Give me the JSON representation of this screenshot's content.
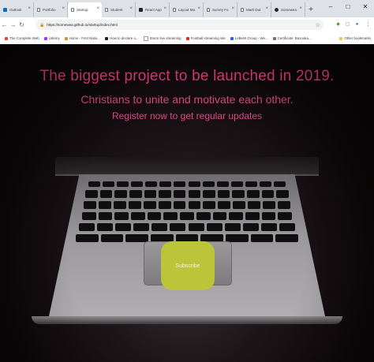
{
  "browser": {
    "tabs": [
      {
        "title": "Outlook",
        "icon": "outlook-icon"
      },
      {
        "title": "Portfolio",
        "icon": "document-icon"
      },
      {
        "title": "Startup",
        "icon": "document-icon",
        "active": true
      },
      {
        "title": "Student",
        "icon": "document-icon"
      },
      {
        "title": "React App",
        "icon": "react-icon"
      },
      {
        "title": "Layout Ma",
        "icon": "document-icon"
      },
      {
        "title": "Survey Fo",
        "icon": "document-icon"
      },
      {
        "title": "Mark Out",
        "icon": "document-icon"
      },
      {
        "title": "Somewea",
        "icon": "github-icon"
      }
    ],
    "new_tab_label": "+",
    "window_controls": {
      "minimize": "–",
      "maximize": "□",
      "close": "✕"
    },
    "url": "https://somewea.github.io/startup/index.html",
    "bookmarks": [
      {
        "label": "The Complete Web",
        "color": "#e04a3a"
      },
      {
        "label": "Udemy",
        "color": "#a435f0"
      },
      {
        "label": "Home - First Natio...",
        "color": "#c79a2e"
      },
      {
        "label": "How to declare o...",
        "color": "#202124"
      },
      {
        "label": "Storm live streaming",
        "color": "#ffffff"
      },
      {
        "label": "Football streaming site",
        "color": "#d93025"
      },
      {
        "label": "LeBeW Group - We...",
        "color": "#3a5bd9"
      },
      {
        "label": "Certificate: Bazooka...",
        "color": "#777777"
      }
    ],
    "other_bookmarks": "Other bookmarks"
  },
  "hero": {
    "title": "The biggest project to be launched in 2019.",
    "subtitle": "Christians to unite and motivate each other.",
    "cta_text": "Register now to get regular updates",
    "button_label": "Subscribe"
  },
  "colors": {
    "accent_pink": "#ea3f86",
    "button_green": "#bcc439",
    "background": "#0b0608"
  }
}
